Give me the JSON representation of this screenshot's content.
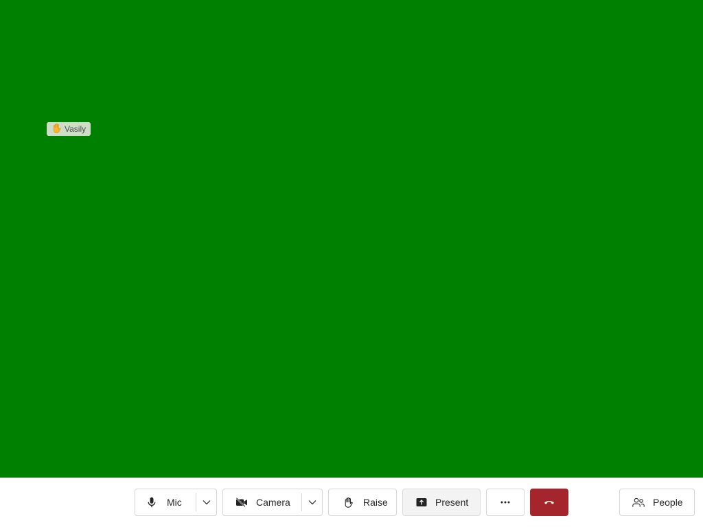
{
  "stage": {
    "background_color": "#008000",
    "participant": {
      "name": "Vasily",
      "hand_raised_icon": "raised-hand-icon"
    }
  },
  "toolbar": {
    "mic": {
      "label": "Mic",
      "icon": "microphone-icon",
      "dropdown_icon": "chevron-down-icon"
    },
    "camera": {
      "label": "Camera",
      "icon": "camera-off-icon",
      "dropdown_icon": "chevron-down-icon"
    },
    "raise": {
      "label": "Raise",
      "icon": "hand-icon"
    },
    "present": {
      "label": "Present",
      "icon": "share-screen-icon"
    },
    "more": {
      "icon": "more-options-icon"
    },
    "hangup": {
      "icon": "hang-up-icon",
      "color": "#a4262c"
    },
    "people": {
      "label": "People",
      "icon": "people-icon"
    }
  }
}
